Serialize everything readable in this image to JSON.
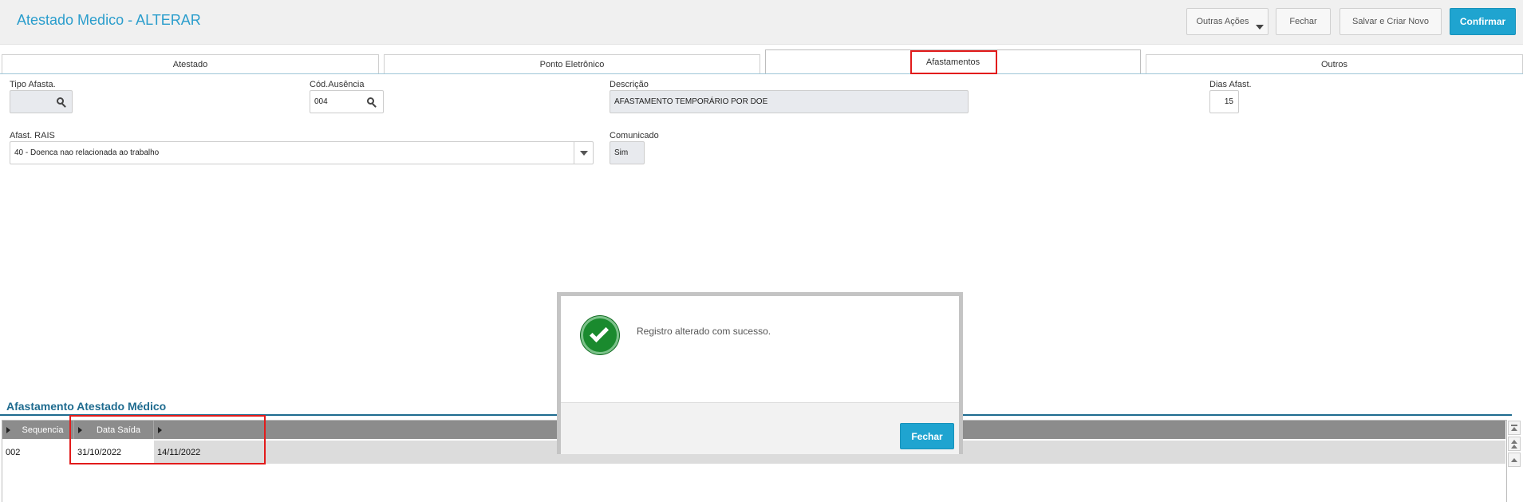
{
  "header": {
    "title": "Atestado Medico - ALTERAR",
    "buttons": {
      "outras_acoes": "Outras Ações",
      "fechar": "Fechar",
      "salvar_criar": "Salvar e Criar Novo",
      "confirmar": "Confirmar"
    }
  },
  "tabs": [
    {
      "label": "Atestado",
      "active": false
    },
    {
      "label": "Ponto Eletrônico",
      "active": false
    },
    {
      "label": "Afastamentos",
      "active": true
    },
    {
      "label": "Outros",
      "active": false
    }
  ],
  "form": {
    "tipo_afasta": {
      "label": "Tipo Afasta.",
      "value": ""
    },
    "cod_ausencia": {
      "label": "Cód.Ausência",
      "value": "004"
    },
    "descricao": {
      "label": "Descrição",
      "value": "AFASTAMENTO TEMPORÁRIO POR DOE"
    },
    "dias_afast": {
      "label": "Dias Afast.",
      "value": "15"
    },
    "afast_rais": {
      "label": "Afast. RAIS",
      "value": "40 - Doenca nao relacionada ao trabalho"
    },
    "comunicado": {
      "label": "Comunicado",
      "value": "Sim"
    }
  },
  "grid": {
    "title": "Afastamento Atestado Médico",
    "columns": [
      "Sequencia",
      "Data Saída",
      ""
    ],
    "rows": [
      [
        "002",
        "31/10/2022",
        "14/11/2022"
      ]
    ]
  },
  "modal": {
    "message": "Registro alterado com sucesso.",
    "button": "Fechar"
  },
  "icons": {
    "search": "search-icon",
    "success": "check-circle-icon",
    "dropdown": "chevron-down-icon"
  },
  "colors": {
    "accent": "#1fa4d0",
    "title": "#2a9dcc",
    "success": "#1a8a2e",
    "highlight": "#e21b1b"
  }
}
